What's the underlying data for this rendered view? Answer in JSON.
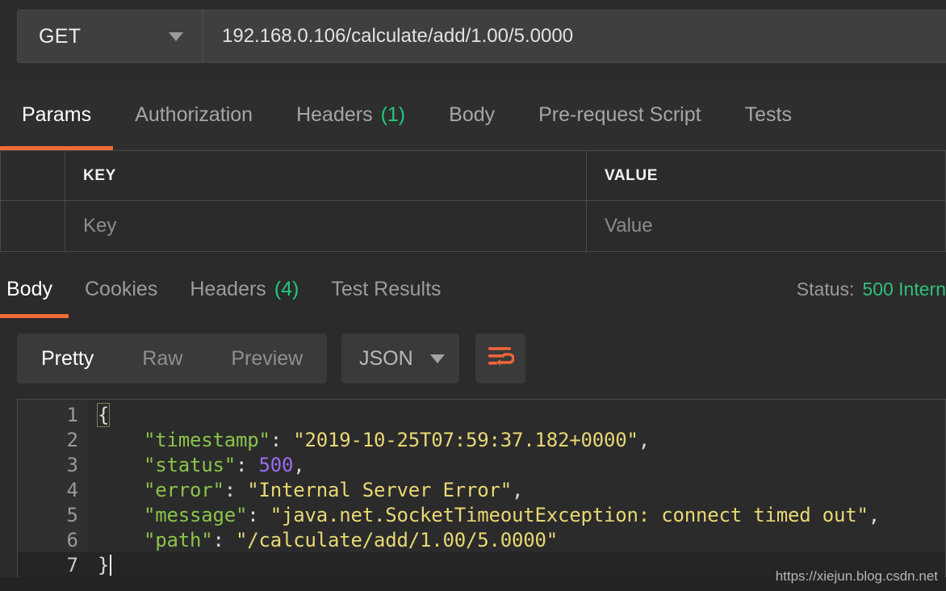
{
  "request": {
    "method": "GET",
    "method_caret_icon": "chevron-down-icon",
    "url": "192.168.0.106/calculate/add/1.00/5.0000",
    "tabs": [
      {
        "label": "Params",
        "count": "",
        "active": true
      },
      {
        "label": "Authorization",
        "count": "",
        "active": false
      },
      {
        "label": "Headers",
        "count": "(1)",
        "active": false
      },
      {
        "label": "Body",
        "count": "",
        "active": false
      },
      {
        "label": "Pre-request Script",
        "count": "",
        "active": false
      },
      {
        "label": "Tests",
        "count": "",
        "active": false
      }
    ]
  },
  "params_table": {
    "headers": {
      "key": "KEY",
      "value": "VALUE"
    },
    "placeholders": {
      "key": "Key",
      "value": "Value"
    }
  },
  "response": {
    "tabs": [
      {
        "label": "Body",
        "count": "",
        "active": true
      },
      {
        "label": "Cookies",
        "count": "",
        "active": false
      },
      {
        "label": "Headers",
        "count": "(4)",
        "active": false
      },
      {
        "label": "Test Results",
        "count": "",
        "active": false
      }
    ],
    "status_label": "Status:",
    "status_value": "500 Intern",
    "toolbar": {
      "view_modes": [
        {
          "label": "Pretty",
          "active": true
        },
        {
          "label": "Raw",
          "active": false
        },
        {
          "label": "Preview",
          "active": false
        }
      ],
      "format": "JSON",
      "format_caret_icon": "chevron-down-icon",
      "wrap_icon": "word-wrap-icon"
    },
    "body_lines": [
      {
        "n": "1",
        "fold": true,
        "current": false,
        "segments": [
          {
            "t": "{",
            "c": "pun-match"
          }
        ]
      },
      {
        "n": "2",
        "fold": false,
        "current": false,
        "segments": [
          {
            "t": "    ",
            "c": "pun"
          },
          {
            "t": "\"timestamp\"",
            "c": "key"
          },
          {
            "t": ": ",
            "c": "pun"
          },
          {
            "t": "\"2019-10-25T07:59:37.182+0000\"",
            "c": "str"
          },
          {
            "t": ",",
            "c": "pun"
          }
        ]
      },
      {
        "n": "3",
        "fold": false,
        "current": false,
        "segments": [
          {
            "t": "    ",
            "c": "pun"
          },
          {
            "t": "\"status\"",
            "c": "key"
          },
          {
            "t": ": ",
            "c": "pun"
          },
          {
            "t": "500",
            "c": "num"
          },
          {
            "t": ",",
            "c": "pun"
          }
        ]
      },
      {
        "n": "4",
        "fold": false,
        "current": false,
        "segments": [
          {
            "t": "    ",
            "c": "pun"
          },
          {
            "t": "\"error\"",
            "c": "key"
          },
          {
            "t": ": ",
            "c": "pun"
          },
          {
            "t": "\"Internal Server Error\"",
            "c": "str"
          },
          {
            "t": ",",
            "c": "pun"
          }
        ]
      },
      {
        "n": "5",
        "fold": false,
        "current": false,
        "segments": [
          {
            "t": "    ",
            "c": "pun"
          },
          {
            "t": "\"message\"",
            "c": "key"
          },
          {
            "t": ": ",
            "c": "pun"
          },
          {
            "t": "\"java.net.SocketTimeoutException: connect timed out\"",
            "c": "str"
          },
          {
            "t": ",",
            "c": "pun"
          }
        ]
      },
      {
        "n": "6",
        "fold": false,
        "current": false,
        "segments": [
          {
            "t": "    ",
            "c": "pun"
          },
          {
            "t": "\"path\"",
            "c": "key"
          },
          {
            "t": ": ",
            "c": "pun"
          },
          {
            "t": "\"/calculate/add/1.00/5.0000\"",
            "c": "str"
          }
        ]
      },
      {
        "n": "7",
        "fold": false,
        "current": true,
        "segments": [
          {
            "t": "}",
            "c": "pun"
          }
        ],
        "caret": true
      }
    ]
  },
  "watermark": "https://xiejun.blog.csdn.net",
  "colors": {
    "accent": "#f06a35",
    "count_green": "#23c87e",
    "status_green": "#31c07b",
    "background": "#2b2b2b",
    "panel": "#3f3f3f",
    "json_key": "#8bc34a",
    "json_string": "#e8d874",
    "json_number": "#9b6cf0"
  }
}
